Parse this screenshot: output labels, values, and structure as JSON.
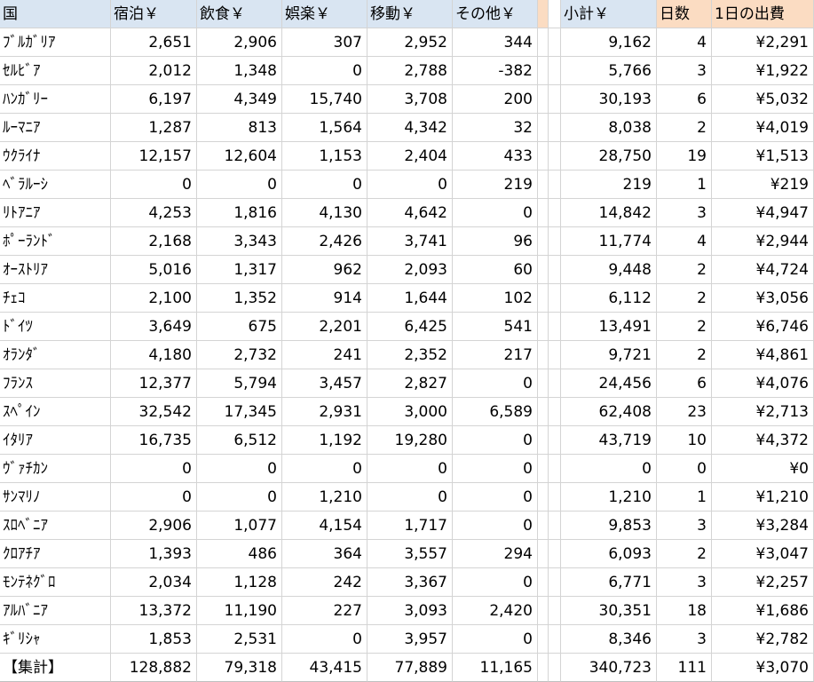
{
  "headers": {
    "country": "国",
    "lodging": "宿泊￥",
    "food": "飲食￥",
    "entertainment": "娯楽￥",
    "transport": "移動￥",
    "other": "その他￥",
    "subtotal": "小計￥",
    "days": "日数",
    "per_day": "1日の出費"
  },
  "rows": [
    {
      "country": "ﾌﾞﾙｶﾞﾘｱ",
      "lodging": "2,651",
      "food": "2,906",
      "entertainment": "307",
      "transport": "2,952",
      "other": "344",
      "subtotal": "9,162",
      "days": "4",
      "per_day": "¥2,291"
    },
    {
      "country": "ｾﾙﾋﾞｱ",
      "lodging": "2,012",
      "food": "1,348",
      "entertainment": "0",
      "transport": "2,788",
      "other": "-382",
      "subtotal": "5,766",
      "days": "3",
      "per_day": "¥1,922"
    },
    {
      "country": "ﾊﾝｶﾞﾘｰ",
      "lodging": "6,197",
      "food": "4,349",
      "entertainment": "15,740",
      "transport": "3,708",
      "other": "200",
      "subtotal": "30,193",
      "days": "6",
      "per_day": "¥5,032"
    },
    {
      "country": "ﾙｰﾏﾆｱ",
      "lodging": "1,287",
      "food": "813",
      "entertainment": "1,564",
      "transport": "4,342",
      "other": "32",
      "subtotal": "8,038",
      "days": "2",
      "per_day": "¥4,019"
    },
    {
      "country": "ｳｸﾗｲﾅ",
      "lodging": "12,157",
      "food": "12,604",
      "entertainment": "1,153",
      "transport": "2,404",
      "other": "433",
      "subtotal": "28,750",
      "days": "19",
      "per_day": "¥1,513"
    },
    {
      "country": "ﾍﾞﾗﾙｰｼ",
      "lodging": "0",
      "food": "0",
      "entertainment": "0",
      "transport": "0",
      "other": "219",
      "subtotal": "219",
      "days": "1",
      "per_day": "¥219"
    },
    {
      "country": "ﾘﾄｱﾆｱ",
      "lodging": "4,253",
      "food": "1,816",
      "entertainment": "4,130",
      "transport": "4,642",
      "other": "0",
      "subtotal": "14,842",
      "days": "3",
      "per_day": "¥4,947"
    },
    {
      "country": "ﾎﾟｰﾗﾝﾄﾞ",
      "lodging": "2,168",
      "food": "3,343",
      "entertainment": "2,426",
      "transport": "3,741",
      "other": "96",
      "subtotal": "11,774",
      "days": "4",
      "per_day": "¥2,944"
    },
    {
      "country": "ｵｰｽﾄﾘｱ",
      "lodging": "5,016",
      "food": "1,317",
      "entertainment": "962",
      "transport": "2,093",
      "other": "60",
      "subtotal": "9,448",
      "days": "2",
      "per_day": "¥4,724"
    },
    {
      "country": "ﾁｪｺ",
      "lodging": "2,100",
      "food": "1,352",
      "entertainment": "914",
      "transport": "1,644",
      "other": "102",
      "subtotal": "6,112",
      "days": "2",
      "per_day": "¥3,056"
    },
    {
      "country": "ﾄﾞｲﾂ",
      "lodging": "3,649",
      "food": "675",
      "entertainment": "2,201",
      "transport": "6,425",
      "other": "541",
      "subtotal": "13,491",
      "days": "2",
      "per_day": "¥6,746"
    },
    {
      "country": "ｵﾗﾝﾀﾞ",
      "lodging": "4,180",
      "food": "2,732",
      "entertainment": "241",
      "transport": "2,352",
      "other": "217",
      "subtotal": "9,721",
      "days": "2",
      "per_day": "¥4,861"
    },
    {
      "country": "ﾌﾗﾝｽ",
      "lodging": "12,377",
      "food": "5,794",
      "entertainment": "3,457",
      "transport": "2,827",
      "other": "0",
      "subtotal": "24,456",
      "days": "6",
      "per_day": "¥4,076"
    },
    {
      "country": "ｽﾍﾟｲﾝ",
      "lodging": "32,542",
      "food": "17,345",
      "entertainment": "2,931",
      "transport": "3,000",
      "other": "6,589",
      "subtotal": "62,408",
      "days": "23",
      "per_day": "¥2,713"
    },
    {
      "country": "ｲﾀﾘｱ",
      "lodging": "16,735",
      "food": "6,512",
      "entertainment": "1,192",
      "transport": "19,280",
      "other": "0",
      "subtotal": "43,719",
      "days": "10",
      "per_day": "¥4,372"
    },
    {
      "country": "ｳﾞｧﾁｶﾝ",
      "lodging": "0",
      "food": "0",
      "entertainment": "0",
      "transport": "0",
      "other": "0",
      "subtotal": "0",
      "days": "0",
      "per_day": "¥0"
    },
    {
      "country": "ｻﾝﾏﾘﾉ",
      "lodging": "0",
      "food": "0",
      "entertainment": "1,210",
      "transport": "0",
      "other": "0",
      "subtotal": "1,210",
      "days": "1",
      "per_day": "¥1,210"
    },
    {
      "country": "ｽﾛﾍﾞﾆｱ",
      "lodging": "2,906",
      "food": "1,077",
      "entertainment": "4,154",
      "transport": "1,717",
      "other": "0",
      "subtotal": "9,853",
      "days": "3",
      "per_day": "¥3,284"
    },
    {
      "country": "ｸﾛｱﾁｱ",
      "lodging": "1,393",
      "food": "486",
      "entertainment": "364",
      "transport": "3,557",
      "other": "294",
      "subtotal": "6,093",
      "days": "2",
      "per_day": "¥3,047"
    },
    {
      "country": "ﾓﾝﾃﾈｸﾞﾛ",
      "lodging": "2,034",
      "food": "1,128",
      "entertainment": "242",
      "transport": "3,367",
      "other": "0",
      "subtotal": "6,771",
      "days": "3",
      "per_day": "¥2,257"
    },
    {
      "country": "ｱﾙﾊﾞﾆｱ",
      "lodging": "13,372",
      "food": "11,190",
      "entertainment": "227",
      "transport": "3,093",
      "other": "2,420",
      "subtotal": "30,351",
      "days": "18",
      "per_day": "¥1,686"
    },
    {
      "country": "ｷﾞﾘｼｬ",
      "lodging": "1,853",
      "food": "2,531",
      "entertainment": "0",
      "transport": "3,957",
      "other": "0",
      "subtotal": "8,346",
      "days": "3",
      "per_day": "¥2,782"
    }
  ],
  "total": {
    "country": "【集計】",
    "lodging": "128,882",
    "food": "79,318",
    "entertainment": "43,415",
    "transport": "77,889",
    "other": "11,165",
    "subtotal": "340,723",
    "days": "111",
    "per_day": "¥3,070"
  },
  "colors": {
    "header_blue": "#d9e5f2",
    "header_peach": "#fbdcc2",
    "gridline": "#d4d4d4"
  }
}
